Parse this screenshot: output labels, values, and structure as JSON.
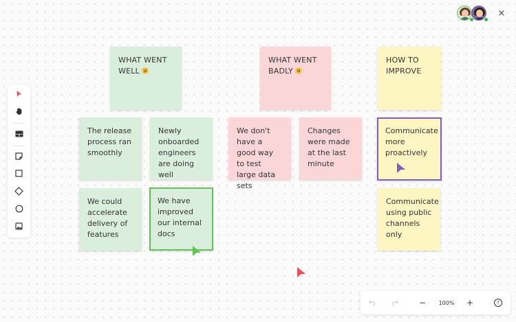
{
  "columns": [
    {
      "title_line1": "WHAT WENT",
      "title_line2": "WELL",
      "color": "#d9eedd"
    },
    {
      "title_line1": "WHAT WENT",
      "title_line2": "BADLY",
      "color": "#fbd6d9"
    },
    {
      "title_line1": "HOW TO",
      "title_line2": "IMPROVE",
      "color": "#fdf5c2"
    }
  ],
  "notes": {
    "well_1": "The release process ran smoothly",
    "well_2": "Newly onboarded engineers are doing well",
    "well_3": "We could accelerate delivery of features",
    "well_4": "We have improved our internal docs",
    "bad_1": "We don't have a good way to test large data sets",
    "bad_2": "Changes were made at the last minute",
    "improve_1": "Communicate more proactively",
    "improve_2": "Communicate using public channels only"
  },
  "toolbar": {
    "tools": [
      "select-pointer-icon",
      "hand-pan-icon",
      "table-icon",
      "sticky-note-icon",
      "rectangle-icon",
      "diamond-icon",
      "circle-icon",
      "image-icon"
    ],
    "active_color": "#e8505b"
  },
  "zoom": {
    "level": "100%",
    "minus": "−",
    "plus": "+",
    "help": "?"
  },
  "window": {
    "close": "×"
  },
  "colors": {
    "cursor_purple": "#7b5fb8",
    "cursor_green": "#62c255",
    "cursor_red": "#e8505b"
  }
}
